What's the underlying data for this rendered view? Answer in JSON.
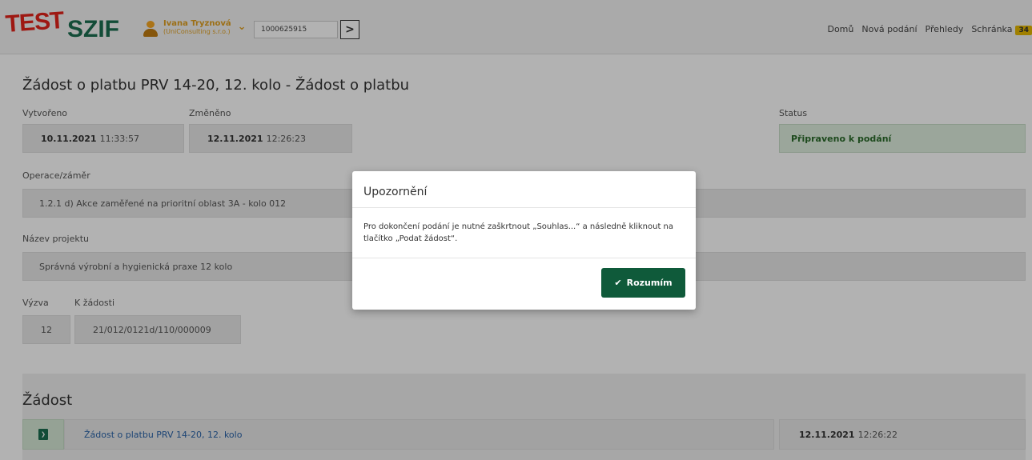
{
  "header": {
    "logo_test": "TEST",
    "logo_szif": "SZIF",
    "user_name": "Ivana Tryznová",
    "user_company": "(UniConsulting s.r.o.)",
    "id_value": "1000625915",
    "go_icon": ">",
    "nav": [
      "Domů",
      "Nová podání",
      "Přehledy",
      "Schránka"
    ],
    "inbox_count": "34"
  },
  "page": {
    "title": "Žádost o platbu PRV 14-20, 12. kolo - Žádost o platbu",
    "created_label": "Vytvořeno",
    "created_date": "10.11.2021",
    "created_time": "11:33:57",
    "changed_label": "Změněno",
    "changed_date": "12.11.2021",
    "changed_time": "12:26:23",
    "status_label": "Status",
    "status_value": "Připraveno k podání",
    "operation_label": "Operace/záměr",
    "operation_value": "1.2.1 d) Akce zaměřené na prioritní oblast 3A - kolo 012",
    "project_label": "Název projektu",
    "project_value": "Správná výrobní a hygienická praxe 12 kolo",
    "call_label": "Výzva",
    "call_value": "12",
    "request_label": "K žádosti",
    "request_value": "21/012/0121d/110/000009"
  },
  "section": {
    "title": "Žádost",
    "doc_link": "Žádost o platbu PRV 14-20, 12. kolo",
    "doc_date": "12.11.2021",
    "doc_time": "12:26:22",
    "doc_icon": "pdf-icon"
  },
  "modal": {
    "title": "Upozornění",
    "body": "Pro dokončení podání je nutné zaškrtnout „Souhlas...“ a následně kliknout na tlačítko „Podat žádost“.",
    "ok_label": "Rozumím",
    "ok_icon": "✔"
  },
  "colors": {
    "brand_green": "#1a6d50",
    "test_red": "#e2231a",
    "button_green": "#0f5a3a",
    "status_green": "#2a6a2a",
    "link_blue": "#2a63a8"
  }
}
